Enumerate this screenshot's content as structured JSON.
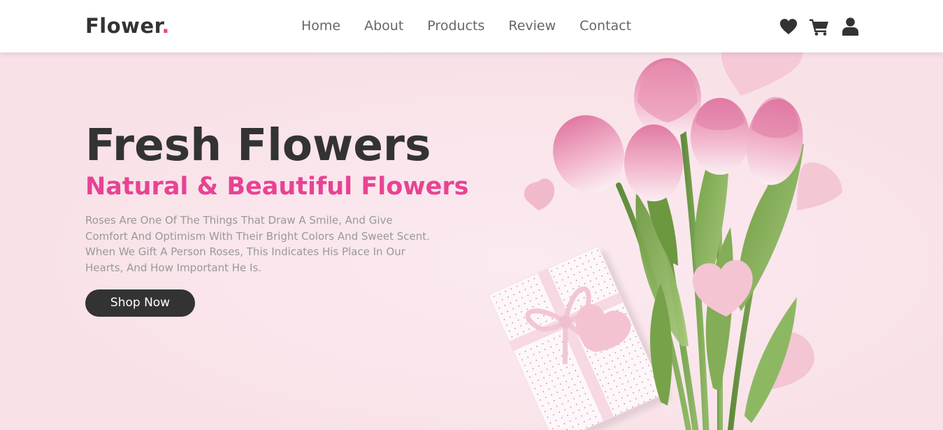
{
  "header": {
    "logo_text": "Flower",
    "logo_dot": ".",
    "nav": [
      {
        "label": "Home"
      },
      {
        "label": "About"
      },
      {
        "label": "Products"
      },
      {
        "label": "Review"
      },
      {
        "label": "Contact"
      }
    ],
    "icons": [
      "heart-icon",
      "shopping-cart-icon",
      "user-icon"
    ]
  },
  "hero": {
    "title": "Fresh Flowers",
    "subtitle": "Natural & Beautiful Flowers",
    "text": "Roses Are One Of The Things That Draw A Smile, And Give Comfort And Optimism With Their Bright Colors And Sweet Scent. When We Gift A Person Roses, This Indicates His Place In Our Hearts, And How Important He Is.",
    "button_label": "Shop Now"
  },
  "colors": {
    "accent": "#e84393",
    "dark": "#333333",
    "hero_background": "#f8e1e7",
    "body_text": "#999999"
  }
}
